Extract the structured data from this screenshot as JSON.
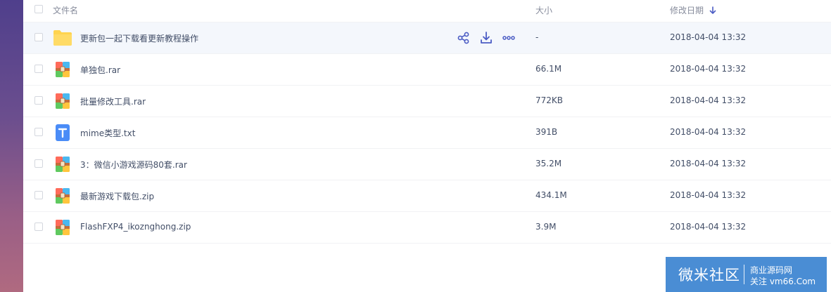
{
  "header": {
    "name_label": "文件名",
    "size_label": "大小",
    "date_label": "修改日期"
  },
  "files": [
    {
      "name": "更新包一起下载看更新教程操作",
      "size": "-",
      "date": "2018-04-04 13:32",
      "icon": "folder-icon"
    },
    {
      "name": "单独包.rar",
      "size": "66.1M",
      "date": "2018-04-04 13:32",
      "icon": "archive-icon"
    },
    {
      "name": "批量修改工具.rar",
      "size": "772KB",
      "date": "2018-04-04 13:32",
      "icon": "archive-icon"
    },
    {
      "name": "mime类型.txt",
      "size": "391B",
      "date": "2018-04-04 13:32",
      "icon": "text-file-icon"
    },
    {
      "name": "3：微信小游戏源码80套.rar",
      "size": "35.2M",
      "date": "2018-04-04 13:32",
      "icon": "archive-icon"
    },
    {
      "name": "最新游戏下载包.zip",
      "size": "434.1M",
      "date": "2018-04-04 13:32",
      "icon": "archive-icon"
    },
    {
      "name": "FlashFXP4_ikoznghong.zip",
      "size": "3.9M",
      "date": "2018-04-04 13:32",
      "icon": "archive-icon"
    }
  ],
  "watermark": {
    "main": "微米社区",
    "line1": "商业源码网",
    "line2": "关注 vm66.Com"
  },
  "colors": {
    "accent": "#4b5cc4",
    "folder": "#ffd44f",
    "text_file": "#4a8cf7",
    "watermark_bg": "#4a8dd4"
  }
}
